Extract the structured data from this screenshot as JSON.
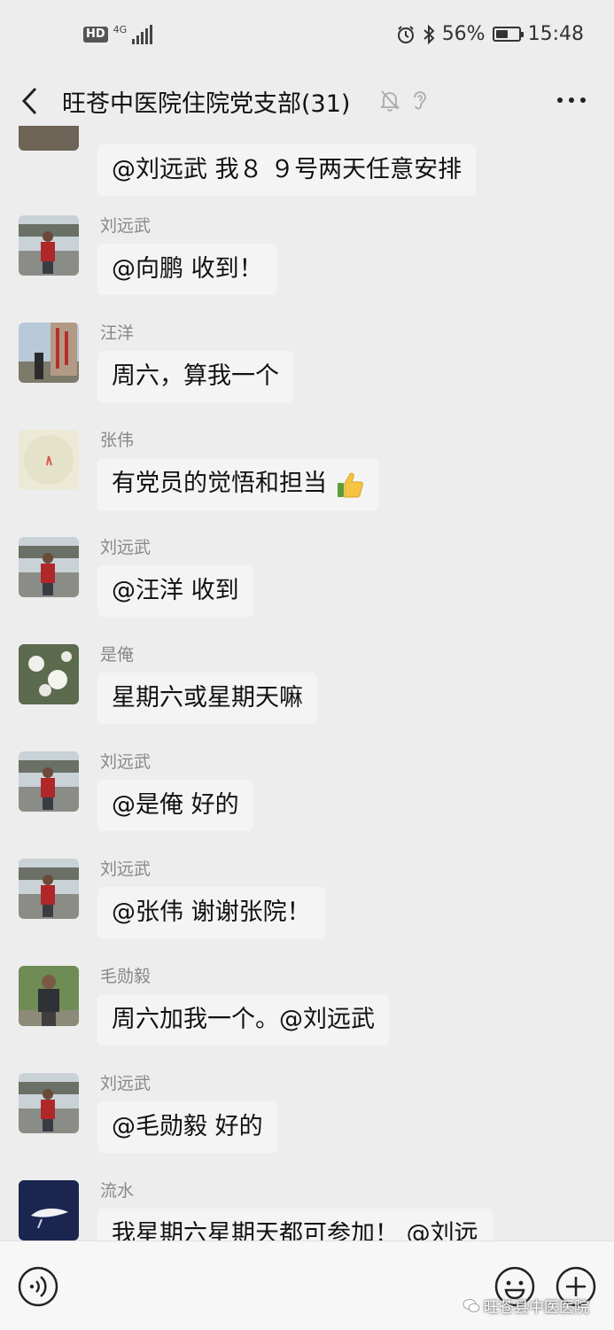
{
  "status_bar": {
    "hd": "HD",
    "network": "4G",
    "battery_percent": "56%",
    "battery_level": 0.56,
    "time": "15:48"
  },
  "header": {
    "title": "旺苍中医院住院党支部(31)"
  },
  "messages": [
    {
      "sender": "",
      "text": "@刘远武  我８  ９号两天任意安排",
      "avatar": "landscape"
    },
    {
      "sender": "刘远武",
      "text": "@向鹏  收到！",
      "avatar": "person-river"
    },
    {
      "sender": "汪洋",
      "text": "周六，算我一个",
      "avatar": "stone-sign"
    },
    {
      "sender": "张伟",
      "text": "有党员的觉悟和担当",
      "avatar": "pale-flower",
      "emoji": "thumbs-up-icon"
    },
    {
      "sender": "刘远武",
      "text": "@汪洋  收到",
      "avatar": "person-river"
    },
    {
      "sender": "是俺",
      "text": "星期六或星期天嘛",
      "avatar": "white-blossom"
    },
    {
      "sender": "刘远武",
      "text": "@是俺  好的",
      "avatar": "person-river"
    },
    {
      "sender": "刘远武",
      "text": "@张伟  谢谢张院！",
      "avatar": "person-river"
    },
    {
      "sender": "毛勋毅",
      "text": "周六加我一个。@刘远武",
      "avatar": "person-green"
    },
    {
      "sender": "刘远武",
      "text": "@毛勋毅  好的",
      "avatar": "person-river"
    },
    {
      "sender": "流水",
      "text": "我星期六星期天都可参加！ @刘远",
      "avatar": "dark-bird"
    }
  ],
  "input_bar": {
    "watermark": "旺苍县中医医院"
  },
  "colors": {
    "background": "#ededed",
    "bubble": "#f4f4f4",
    "sender": "#888888"
  }
}
